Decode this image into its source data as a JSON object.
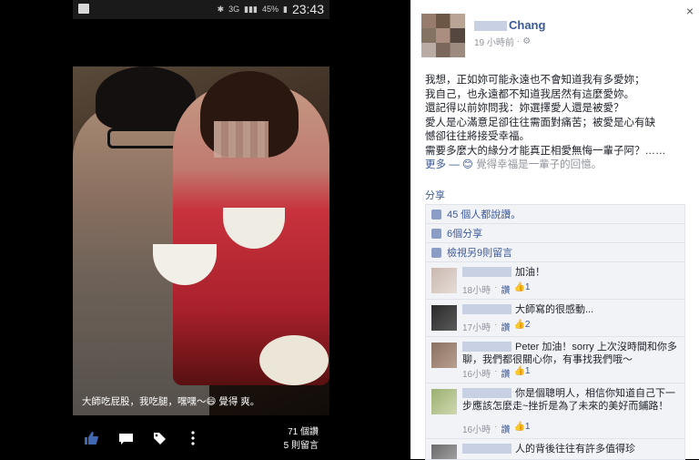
{
  "status_bar": {
    "network": "3G",
    "battery": "45%",
    "time": "23:43"
  },
  "photo": {
    "caption": "大師吃屁股，我吃腿，嘿嘿～😄 覺得 爽。",
    "likes": "71 個讚",
    "comments": "5 則留言"
  },
  "panel": {
    "close": "×",
    "author_name": "Chang",
    "post_time": "19 小時前",
    "post_lines": [
      "我想，正如妳可能永遠也不會知道我有多愛妳；",
      "我自己，也永遠都不知道我居然有這麼愛妳。",
      "還記得以前妳問我：妳選擇愛人還是被愛？",
      "愛人是心滿意足卻往往需面對痛苦；被愛是心有缺",
      "憾卻往往將接受幸福。",
      "需要多麼大的緣分才能真正相愛無悔一輩子阿？……"
    ],
    "more_label": "更多",
    "feeling": "覺得幸福是一輩子的回憶。",
    "share": "分享",
    "likes_row": "45 個人都說讚。",
    "shares_row": "6個分享",
    "view_comments": "檢視另9則留言",
    "comments": [
      {
        "text": "加油！",
        "time": "18小時",
        "like": "讚",
        "likes": "1"
      },
      {
        "text": "大師寫的很感動...",
        "time": "17小時",
        "like": "讚",
        "likes": "2"
      },
      {
        "text": "Peter 加油！sorry 上次沒時間和你多聊，我們都很關心你，有事找我們哦～",
        "time": "16小時",
        "like": "讚",
        "likes": "1"
      },
      {
        "text": "你是個聰明人，相信你知道自己下一步應該怎麼走~挫折是為了未來的美好而鋪路！",
        "time": "16小時",
        "like": "讚",
        "likes": "1"
      },
      {
        "text": "人的背後往往有許多值得珍"
      }
    ]
  }
}
